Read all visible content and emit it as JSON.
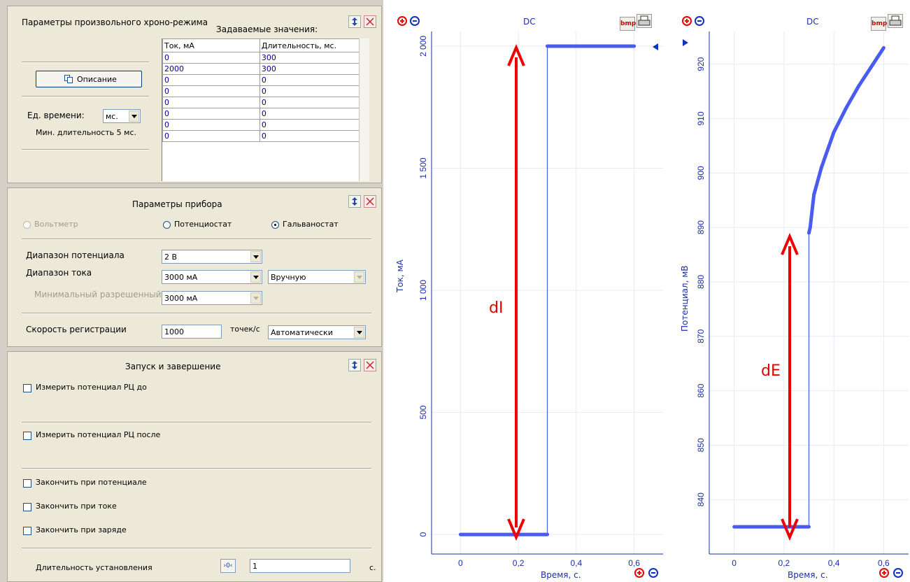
{
  "chrono": {
    "title": "Параметры произвольного хроно-режима",
    "values_title": "Задаваемые значения:",
    "description_button": "Описание",
    "time_unit_label": "Ед. времени:",
    "time_unit_value": "мс.",
    "min_duration": "Мин. длительность 5 мс.",
    "table": {
      "headers": [
        "Ток, мА",
        "Длительность, мс."
      ],
      "rows": [
        [
          "0",
          "300"
        ],
        [
          "2000",
          "300"
        ],
        [
          "0",
          "0"
        ],
        [
          "0",
          "0"
        ],
        [
          "0",
          "0"
        ],
        [
          "0",
          "0"
        ],
        [
          "0",
          "0"
        ],
        [
          "0",
          "0"
        ]
      ]
    }
  },
  "device": {
    "title": "Параметры прибора",
    "mode_voltmeter": "Вольтметр",
    "mode_potentiostat": "Потенциостат",
    "mode_galvanostat": "Гальваностат",
    "selected_mode": "Гальваностат",
    "potential_range_label": "Диапазон потенциала",
    "potential_range_value": "2 В",
    "current_range_label": "Диапазон тока",
    "current_range_value": "3000 мА",
    "current_mode_value": "Вручную",
    "min_allowed_label": "Минимальный разрешенный",
    "min_allowed_value": "3000 мА",
    "rate_label": "Скорость регистрации",
    "rate_value": "1000",
    "rate_unit": "точек/с",
    "rate_mode_value": "Автоматически"
  },
  "run": {
    "title": "Запуск и завершение",
    "measure_before": "Измерить потенциал РЦ до",
    "measure_after": "Измерить потенциал РЦ после",
    "end_potential": "Закончить при потенциале",
    "end_current": "Закончить при токе",
    "end_charge": "Закончить при заряде",
    "settle_label": "Длительность установления",
    "settle_value": "1",
    "settle_unit": "с.",
    "zero_button": "›0‹"
  },
  "chart_data": [
    {
      "type": "line",
      "title": "DC",
      "xlabel": "Время, с.",
      "ylabel": "Ток, мА",
      "xlim": [
        -0.1,
        0.7
      ],
      "ylim": [
        -80,
        2060
      ],
      "x_ticks": [
        "0",
        "0,2",
        "0,4",
        "0,6"
      ],
      "y_ticks": [
        "0",
        "500",
        "1 000",
        "1 500",
        "2 000"
      ],
      "annotation": "dI",
      "series": [
        {
          "x": [
            0,
            0.3,
            0.3,
            0.6
          ],
          "y": [
            0,
            0,
            2000,
            2000
          ],
          "color": "#4a5bf0"
        }
      ],
      "grid": true
    },
    {
      "type": "line",
      "title": "DC",
      "xlabel": "Время, с.",
      "ylabel": "Потенциал, мВ",
      "xlim": [
        -0.1,
        0.7
      ],
      "ylim": [
        830,
        926
      ],
      "x_ticks": [
        "0",
        "0,2",
        "0,4",
        "0,6"
      ],
      "y_ticks": [
        "840",
        "850",
        "860",
        "870",
        "880",
        "890",
        "900",
        "910",
        "920"
      ],
      "annotation": "dE",
      "series": [
        {
          "x": [
            0,
            0.3,
            0.3,
            0.305,
            0.32,
            0.35,
            0.4,
            0.45,
            0.5,
            0.55,
            0.6
          ],
          "y": [
            835,
            835,
            889,
            890,
            896,
            901,
            907.5,
            912,
            916,
            919.5,
            923
          ],
          "color": "#4a5bf0"
        }
      ],
      "grid": true
    }
  ]
}
